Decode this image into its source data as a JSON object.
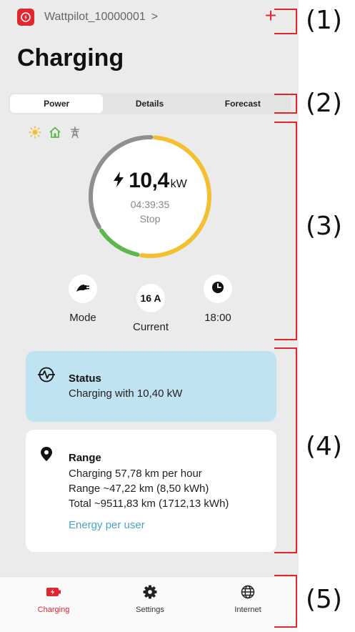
{
  "header": {
    "device_name": "Wattpilot_10000001",
    "chevron": ">",
    "add_label": "+",
    "title": "Charging"
  },
  "tabs": [
    {
      "label": "Power",
      "active": true
    },
    {
      "label": "Details",
      "active": false
    },
    {
      "label": "Forecast",
      "active": false
    }
  ],
  "power": {
    "sources": [
      "sun-icon",
      "home-icon",
      "grid-pylon-icon"
    ],
    "bolt": "⚡",
    "value": "10,4",
    "unit": "kW",
    "time": "04:39:35",
    "stop_label": "Stop",
    "gauge_segments": [
      {
        "name": "grid",
        "color": "#8f8f8f",
        "fraction": 0.35
      },
      {
        "name": "home",
        "color": "#5cb84c",
        "fraction": 0.13
      },
      {
        "name": "solar",
        "color": "#f2c030",
        "fraction": 0.52
      }
    ]
  },
  "controls": {
    "mode_label": "Mode",
    "current_value": "16 A",
    "current_label": "Current",
    "timer_label": "18:00"
  },
  "status_card": {
    "title": "Status",
    "text": "Charging with 10,40 kW"
  },
  "range_card": {
    "title": "Range",
    "lines": [
      "Charging 57,78 km per hour",
      "Range ~47,22 km (8,50 kWh)",
      "Total ~9511,83 km (1712,13 kWh)"
    ],
    "link": "Energy per user"
  },
  "nav": [
    {
      "label": "Charging",
      "icon": "battery-icon",
      "active": true
    },
    {
      "label": "Settings",
      "icon": "gear-icon",
      "active": false
    },
    {
      "label": "Internet",
      "icon": "globe-icon",
      "active": false
    }
  ],
  "callouts": [
    "(1)",
    "(2)",
    "(3)",
    "(4)",
    "(5)"
  ],
  "colors": {
    "accent": "#e0262e",
    "status_bg": "#bfe3f0",
    "link": "#4aa3c9",
    "solar": "#f2c030",
    "home": "#5cb84c",
    "grid": "#8f8f8f"
  }
}
